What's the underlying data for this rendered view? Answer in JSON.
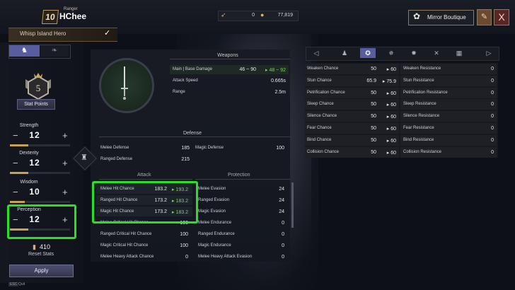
{
  "header": {
    "level": "10",
    "class_name": "Ranger",
    "char_name": "HChee",
    "title": "Whisp Island Hero",
    "currency_a": "0",
    "currency_b": "77,819",
    "mirror_label": "Mirror Boutique",
    "close_label": "X"
  },
  "left": {
    "stat_points_label": "Stat Points",
    "stat_points_value": "5",
    "stats": [
      {
        "name": "Strength",
        "value": "12",
        "bar": 0.3
      },
      {
        "name": "Dexterity",
        "value": "12",
        "bar": 0.3
      },
      {
        "name": "Wisdom",
        "value": "10",
        "bar": 0.25
      },
      {
        "name": "Perception",
        "value": "12",
        "bar": 0.3
      }
    ],
    "reset_value": "410",
    "reset_label": "Reset Stats",
    "apply_label": "Apply",
    "esc_key": "ESC",
    "esc_label": "Quit"
  },
  "weapons": {
    "title": "Weapons",
    "rows": [
      {
        "label": "Main | Base Damage",
        "old": "46 ~ 90",
        "new": "48 ~ 92"
      },
      {
        "label": "Attack Speed",
        "value": "0.665s"
      },
      {
        "label": "Range",
        "value": "2.5m"
      }
    ]
  },
  "defense": {
    "title": "Defense",
    "melee_label": "Melee Defense",
    "melee_value": "185",
    "magic_label": "Magic Defense",
    "magic_value": "100",
    "ranged_label": "Ranged Defense",
    "ranged_value": "215"
  },
  "attack": {
    "tab_attack": "Attack",
    "tab_protection": "Protection",
    "rows": [
      {
        "label": "Melee Hit Chance",
        "old": "183.2",
        "new": "193.2"
      },
      {
        "label": "Ranged Hit Chance",
        "old": "173.2",
        "new": "183.2"
      },
      {
        "label": "Magic Hit Chance",
        "old": "173.2",
        "new": "183.2"
      },
      {
        "label": "Melee Critical Hit Chance",
        "value": "100"
      },
      {
        "label": "Ranged Critical Hit Chance",
        "value": "100"
      },
      {
        "label": "Magic Critical Hit Chance",
        "value": "100"
      },
      {
        "label": "Melee Heavy Attack Chance",
        "value": "0"
      }
    ],
    "protection_rows": [
      {
        "label": "Melee Evasion",
        "value": "24"
      },
      {
        "label": "Ranged Evasion",
        "value": "24"
      },
      {
        "label": "Magic Evasion",
        "value": "24"
      },
      {
        "label": "Melee Endurance",
        "value": "0"
      },
      {
        "label": "Ranged Endurance",
        "value": "0"
      },
      {
        "label": "Magic Endurance",
        "value": "0"
      },
      {
        "label": "Melee Heavy Attack Evasion",
        "value": "0"
      }
    ]
  },
  "right": {
    "chance": [
      {
        "label": "Weaken Chance",
        "old": "50",
        "new": "60"
      },
      {
        "label": "Stun Chance",
        "old": "65.9",
        "new": "75.9"
      },
      {
        "label": "Petrification Chance",
        "old": "50",
        "new": "60"
      },
      {
        "label": "Sleep Chance",
        "old": "50",
        "new": "60"
      },
      {
        "label": "Silence Chance",
        "old": "50",
        "new": "60"
      },
      {
        "label": "Fear Chance",
        "old": "50",
        "new": "60"
      },
      {
        "label": "Bind Chance",
        "old": "50",
        "new": "60"
      },
      {
        "label": "Collision Chance",
        "old": "50",
        "new": "60"
      }
    ],
    "resistance": [
      {
        "label": "Weaken Resistance",
        "value": "0"
      },
      {
        "label": "Stun Resistance",
        "value": "0"
      },
      {
        "label": "Petrification Resistance",
        "value": "0"
      },
      {
        "label": "Sleep Resistance",
        "value": "0"
      },
      {
        "label": "Silence Resistance",
        "value": "0"
      },
      {
        "label": "Fear Resistance",
        "value": "0"
      },
      {
        "label": "Bind Resistance",
        "value": "0"
      },
      {
        "label": "Collision Resistance",
        "value": "0"
      }
    ]
  },
  "colors": {
    "accent": "#5a5ca0",
    "highlight": "#28e028",
    "increase": "#6fdc4a"
  }
}
